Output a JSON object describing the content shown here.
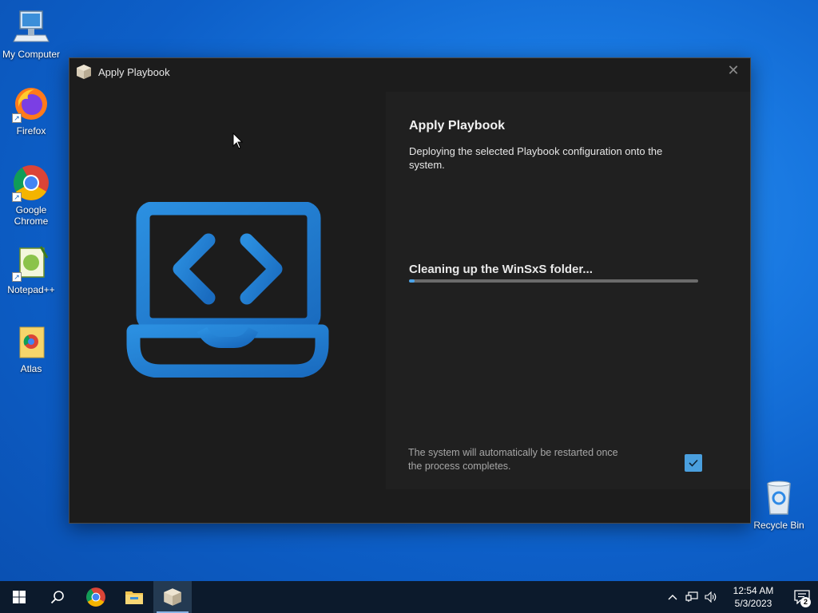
{
  "desktop": {
    "icons": [
      {
        "label": "My Computer"
      },
      {
        "label": "Firefox"
      },
      {
        "label": "Google Chrome"
      },
      {
        "label": "Notepad++"
      },
      {
        "label": "Atlas"
      },
      {
        "label": "Recycle Bin"
      }
    ]
  },
  "window": {
    "title": "Apply Playbook",
    "close_glyph": "✕",
    "panel": {
      "heading": "Apply Playbook",
      "description": "Deploying the selected Playbook configuration onto the system.",
      "status": "Cleaning up the WinSxS folder...",
      "progress_percent": 2,
      "restart_note": "The system will automatically be restarted once the process completes.",
      "restart_checked": true
    }
  },
  "taskbar": {
    "pinned": [
      "start-icon",
      "search-icon",
      "chrome-icon",
      "file-explorer-icon",
      "playbook-app-icon"
    ],
    "clock_time": "12:54 AM",
    "clock_date": "5/3/2023",
    "notification_count": "2"
  },
  "colors": {
    "accent": "#4a9fde",
    "window_bg": "#1c1c1c",
    "panel_bg": "#202020",
    "taskbar_bg": "#0c1a2c"
  }
}
